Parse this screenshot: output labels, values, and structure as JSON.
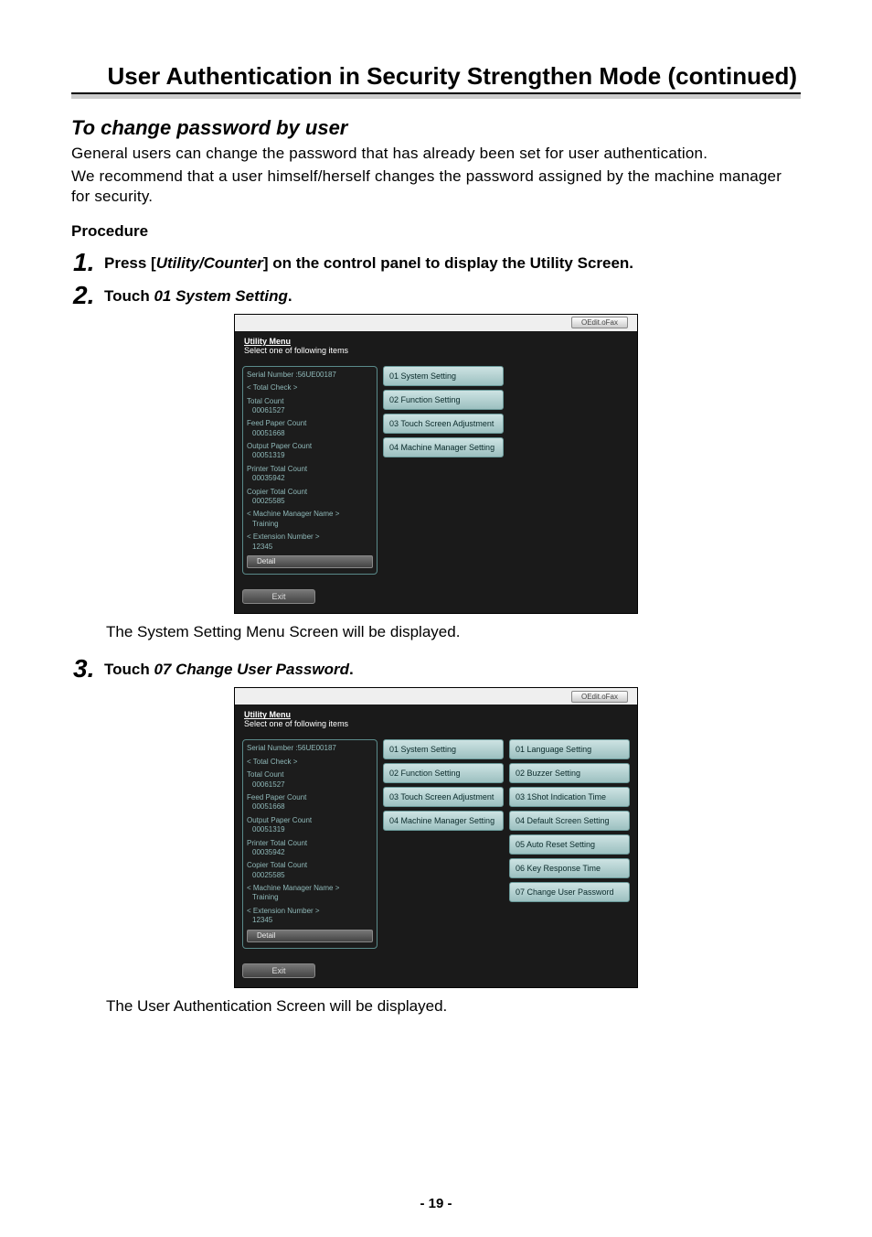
{
  "header": {
    "title": "User Authentication in Security Strengthen Mode (continued)"
  },
  "section": {
    "heading": "To change password by user",
    "para1": "General users can change the password that has already been set for user authentication.",
    "para2": "We recommend that a user himself/herself changes the password assigned by the machine manager for security.",
    "procedure_label": "Procedure"
  },
  "steps": {
    "s1": {
      "num": "1.",
      "pre": "Press [",
      "ital": "Utility/Counter",
      "post": "] on the control panel to display the Utility Screen."
    },
    "s2": {
      "num": "2.",
      "pre": "Touch ",
      "ital": "01 System Setting",
      "post": "."
    },
    "s2_caption": "The System Setting Menu Screen will be displayed.",
    "s3": {
      "num": "3.",
      "pre": "Touch ",
      "ital": "07 Change User Password",
      "post": "."
    },
    "s3_caption": "The User Authentication Screen will be displayed."
  },
  "screen": {
    "tab": "OEdit.oFax",
    "header_line1": "Utility Menu",
    "header_line2": "Select one of following items",
    "sidebar_top": {
      "serial_label": "Serial Number :",
      "serial_value": "56UE00187",
      "total_check": "< Total Check >",
      "total_count": "Total Count",
      "total_count_v": "00061527",
      "feed": "Feed Paper Count",
      "feed_v": "00051668",
      "output": "Output Paper Count",
      "output_v": "00051319",
      "printer": "Printer Total Count",
      "printer_v": "00035942",
      "copier": "Copier Total Count",
      "copier_v": "00025585"
    },
    "sidebar_bottom": {
      "mgr": "< Machine Manager Name >",
      "mgr_v": "Training",
      "ext": "< Extension Number >",
      "ext_v": "12345",
      "detail": "Detail"
    },
    "col1": [
      "01 System Setting",
      "02 Function Setting",
      "03 Touch Screen Adjustment",
      "04 Machine Manager Setting"
    ],
    "col2": [
      "01 Language Setting",
      "02 Buzzer Setting",
      "03 1Shot Indication Time",
      "04 Default Screen Setting",
      "05 Auto Reset Setting",
      "06 Key Response Time",
      "07 Change User Password"
    ],
    "exit": "Exit"
  },
  "footer": {
    "page": "- 19 -"
  }
}
